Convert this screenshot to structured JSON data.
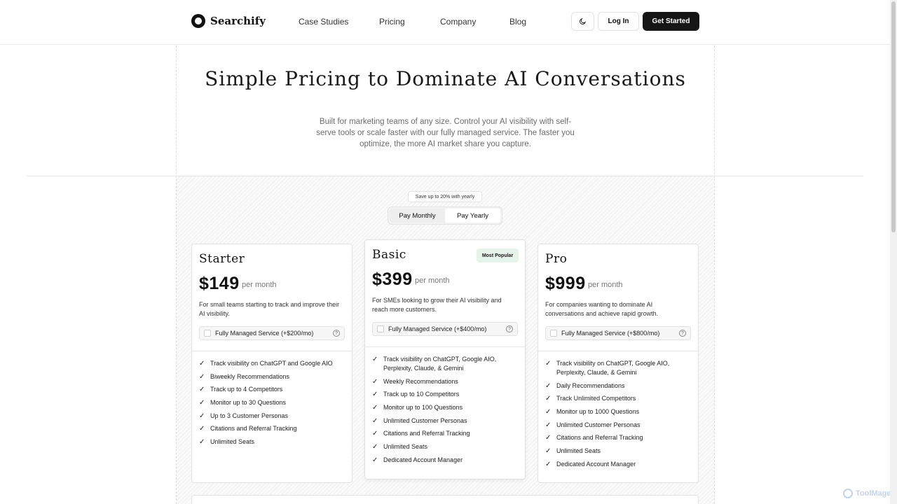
{
  "header": {
    "logo_text": "Searchify",
    "nav": [
      "Case Studies",
      "Pricing",
      "Company",
      "Blog"
    ],
    "theme_icon": "moon-icon",
    "login_label": "Log In",
    "cta_label": "Get Started"
  },
  "hero": {
    "title": "Simple Pricing to Dominate AI Conversations",
    "subtitle": "Built for marketing teams of any size. Control your AI visibility with self-serve tools or scale faster with our fully managed service. The faster you optimize, the more AI market share you capture."
  },
  "billing": {
    "save_badge": "Save up to 20% with yearly",
    "monthly_label": "Pay Monthly",
    "yearly_label": "Pay Yearly",
    "selected": "monthly"
  },
  "plans": [
    {
      "name": "Starter",
      "price": "$149",
      "period": "per month",
      "description": "For small teams starting to track and improve their AI visibility.",
      "managed": "Fully Managed Service (+$200/mo)",
      "features": [
        "Track visibility on ChatGPT and Google AIO",
        "Biweekly Recommendations",
        "Track up to 4 Competitors",
        "Monitor up to 30 Questions",
        "Up to 3 Customer Personas",
        "Citations and Referral Tracking",
        "Unlimited Seats"
      ]
    },
    {
      "name": "Basic",
      "badge": "Most Popular",
      "price": "$399",
      "period": "per month",
      "description": "For SMEs looking to grow their AI visibility and reach more customers.",
      "managed": "Fully Managed Service (+$400/mo)",
      "features": [
        "Track visibility on ChatGPT, Google AIO, Perplexity, Claude, & Gemini",
        "Weekly Recommendations",
        "Track up to 10 Competitors",
        "Monitor up to 100 Questions",
        "Unlimited Customer Personas",
        "Citations and Referral Tracking",
        "Unlimited Seats",
        "Dedicated Account Manager"
      ]
    },
    {
      "name": "Pro",
      "price": "$999",
      "period": "per month",
      "description": "For companies wanting to dominate AI conversations and achieve rapid growth.",
      "managed": "Fully Managed Service (+$800/mo)",
      "features": [
        "Track visibility on ChatGPT, Google AIO, Perplexity, Claude, & Gemini",
        "Daily Recommendations",
        "Track Unlimited Competitors",
        "Monitor up to 1000 Questions",
        "Unlimited Customer Personas",
        "Citations and Referral Tracking",
        "Unlimited Seats",
        "Dedicated Account Manager"
      ]
    }
  ],
  "watermark": "ToolMage"
}
